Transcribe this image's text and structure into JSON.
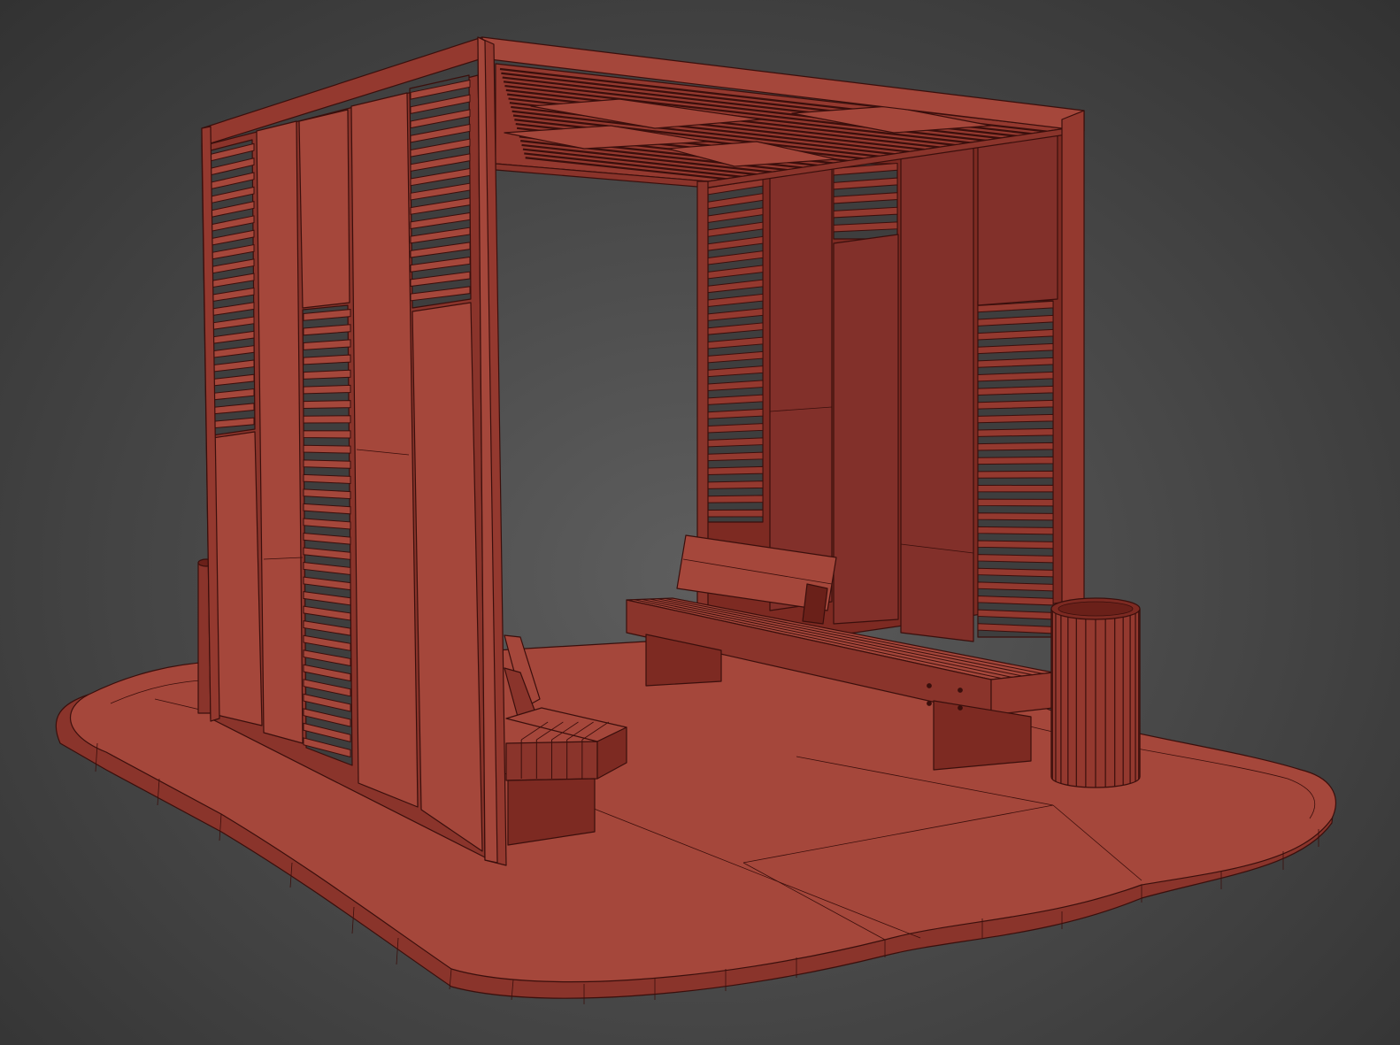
{
  "viewport": {
    "render_mode": "shaded-wireframe",
    "background": "#4a4a4a",
    "colors": {
      "light_face": "#a5473b",
      "mid_face": "#94392f",
      "dark_face": "#7d2a22",
      "deep_face": "#6a2019",
      "edge": "#3a0f0c",
      "gap": "#3e3e3e"
    }
  },
  "scene": {
    "objects": [
      "platform",
      "pergola-frame",
      "roof-slats",
      "left-wall",
      "back-wall",
      "front-bench",
      "back-bench",
      "trash-bin",
      "small-bin"
    ],
    "left_wall": {
      "panels": 5,
      "slatted_panels": 3
    },
    "back_wall": {
      "panels": 5,
      "slatted_panels": 3
    },
    "roof": {
      "slats": 22
    },
    "back_bench": {
      "seat_slats": 6
    },
    "front_bench": {
      "seat_slats": 5
    },
    "trash_bin": {
      "staves": 14
    }
  }
}
